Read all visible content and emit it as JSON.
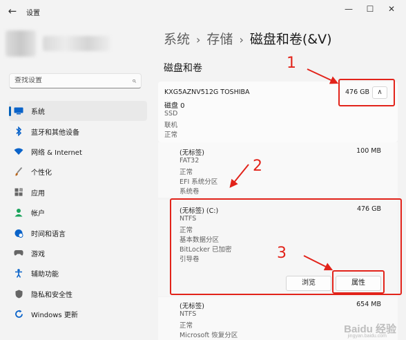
{
  "window": {
    "title": "设置",
    "back_icon": "←",
    "minimize_icon": "—",
    "maximize_icon": "☐",
    "close_icon": "✕"
  },
  "search": {
    "placeholder": "查找设置",
    "icon": "⌕"
  },
  "sidebar": {
    "items": [
      {
        "label": "系统",
        "icon": "monitor-icon",
        "color": "#0a63c9",
        "active": true
      },
      {
        "label": "蓝牙和其他设备",
        "icon": "bluetooth-icon",
        "color": "#0a63c9"
      },
      {
        "label": "网络 & Internet",
        "icon": "wifi-icon",
        "color": "#0a63c9"
      },
      {
        "label": "个性化",
        "icon": "brush-icon",
        "color": "#b7651c"
      },
      {
        "label": "应用",
        "icon": "apps-icon",
        "color": "#555555"
      },
      {
        "label": "帐户",
        "icon": "person-icon",
        "color": "#1aa35b"
      },
      {
        "label": "时间和语言",
        "icon": "globe-clock-icon",
        "color": "#0a63c9"
      },
      {
        "label": "游戏",
        "icon": "gamepad-icon",
        "color": "#555555"
      },
      {
        "label": "辅助功能",
        "icon": "accessibility-icon",
        "color": "#0a63c9"
      },
      {
        "label": "隐私和安全性",
        "icon": "shield-icon",
        "color": "#555555"
      },
      {
        "label": "Windows 更新",
        "icon": "update-icon",
        "color": "#0a63c9"
      }
    ]
  },
  "breadcrumb": {
    "item1": "系统",
    "item2": "存储",
    "current": "磁盘和卷(&V)",
    "separator": "›"
  },
  "section_title": "磁盘和卷",
  "disk": {
    "model": "KXG5AZNV512G TOSHIBA",
    "name": "磁盘 0",
    "type": "SSD",
    "status1": "联机",
    "status2": "正常",
    "size": "476 GB",
    "collapse_icon": "∧"
  },
  "partitions": [
    {
      "label": "(无标签)",
      "size": "100 MB",
      "meta": [
        "FAT32",
        "正常",
        "EFI 系统分区",
        "系统卷"
      ]
    },
    {
      "label": "(无标签) (C:)",
      "size": "476 GB",
      "meta": [
        "NTFS",
        "正常",
        "基本数据分区",
        "BitLocker 已加密",
        "引导卷"
      ]
    },
    {
      "label": "(无标签)",
      "size": "654 MB",
      "meta": [
        "NTFS",
        "正常",
        "Microsoft 恢复分区"
      ]
    }
  ],
  "buttons": {
    "browse": "浏览",
    "properties": "属性"
  },
  "annotations": {
    "n1": "1",
    "n2": "2",
    "n3": "3",
    "color": "#e2231a"
  },
  "watermark": {
    "main": "Baidu 经验",
    "sub": "jingyan.baidu.com"
  }
}
